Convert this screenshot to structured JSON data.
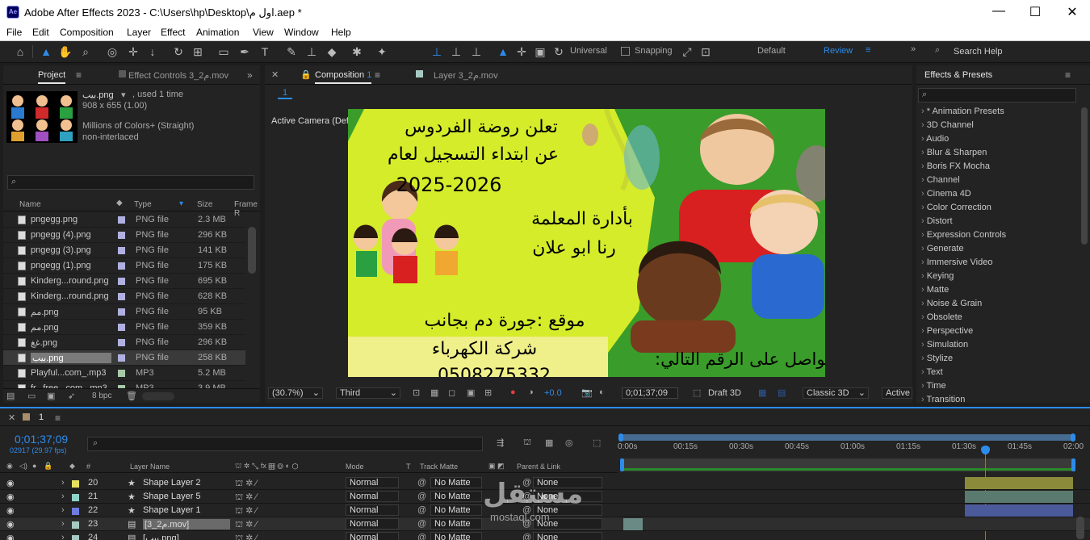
{
  "window": {
    "title": "Adobe After Effects 2023 - C:\\Users\\hp\\Desktop\\اول م.aep *",
    "logo": "Ae",
    "min": "—",
    "max": "☐",
    "close": "✕"
  },
  "menu": [
    "File",
    "Edit",
    "Composition",
    "Layer",
    "Effect",
    "Animation",
    "View",
    "Window",
    "Help"
  ],
  "toolbar": {
    "universal": "Universal",
    "snapping": "Snapping",
    "workspace_default": "Default",
    "workspace_review": "Review",
    "search_help": "Search Help"
  },
  "project": {
    "tab": "Project",
    "effect_controls_tab": "Effect Controls 3_2م.mov",
    "item_name": "بيب.png",
    "used": ", used 1 time",
    "dims": "908 x 655 (1.00)",
    "colors": "Millions of Colors+ (Straight)",
    "interlace": "non-interlaced",
    "bpc": "8 bpc",
    "columns": [
      "Name",
      "Type",
      "Size",
      "Frame R"
    ],
    "files": [
      {
        "name": "pngegg.png",
        "type": "PNG file",
        "size": "2.3 MB"
      },
      {
        "name": "pngegg (4).png",
        "type": "PNG file",
        "size": "296 KB"
      },
      {
        "name": "pngegg (3).png",
        "type": "PNG file",
        "size": "141 KB"
      },
      {
        "name": "pngegg (1).png",
        "type": "PNG file",
        "size": "175 KB"
      },
      {
        "name": "Kinderg...round.png",
        "type": "PNG file",
        "size": "695 KB"
      },
      {
        "name": "Kinderg...round.png",
        "type": "PNG file",
        "size": "628 KB"
      },
      {
        "name": "مم.png",
        "type": "PNG file",
        "size": "95 KB"
      },
      {
        "name": "مم.png",
        "type": "PNG file",
        "size": "359 KB"
      },
      {
        "name": "غغ.png",
        "type": "PNG file",
        "size": "296 KB"
      },
      {
        "name": "بيب.png",
        "type": "PNG file",
        "size": "258 KB"
      },
      {
        "name": "Playful...com_.mp3",
        "type": "MP3",
        "size": "5.2 MB"
      },
      {
        "name": "fr...free...com_.mp3",
        "type": "MP3",
        "size": "3.9 MB"
      }
    ]
  },
  "composition": {
    "tab": "Composition",
    "tab_num": "1",
    "layer_tab": "Layer 3_2م.mov",
    "breadcrumb": "1",
    "camera": "Active Camera (Default)",
    "zoom": "(30.7%)",
    "view": "Third",
    "exposure": "+0.0",
    "timecode": "0;01;37;09",
    "renderer": "Draft 3D",
    "engine": "Classic 3D",
    "camera_dd": "Active",
    "frame": {
      "line1": "تعلن روضة الفردوس",
      "line2": "عن ابتداء التسجيل لعام",
      "line3": "2025-2026",
      "line4": "بأدارة المعلمة",
      "line5": "رنا ابو علان",
      "line6": "موقع :جورة دم بجانب",
      "line7": "شركة الكهرباء",
      "line8": "0508275332",
      "line9": "تواصل على الرقم التالي:"
    }
  },
  "effects": {
    "title": "Effects & Presets",
    "items": [
      "* Animation Presets",
      "3D Channel",
      "Audio",
      "Blur & Sharpen",
      "Boris FX Mocha",
      "Channel",
      "Cinema 4D",
      "Color Correction",
      "Distort",
      "Expression Controls",
      "Generate",
      "Immersive Video",
      "Keying",
      "Matte",
      "Noise & Grain",
      "Obsolete",
      "Perspective",
      "Simulation",
      "Stylize",
      "Text",
      "Time",
      "Transition"
    ]
  },
  "timeline": {
    "tab": "1",
    "timecode": "0;01;37;09",
    "frames": "02917 (29.97 fps)",
    "columns": {
      "num": "#",
      "layer_name": "Layer Name",
      "mode": "Mode",
      "t": "T",
      "track_matte": "Track Matte",
      "parent": "Parent & Link"
    },
    "ruler": [
      "0:00s",
      "00:15s",
      "00:30s",
      "00:45s",
      "01:00s",
      "01:15s",
      "01:30s",
      "01:45s",
      "02:00"
    ],
    "layers": [
      {
        "num": "20",
        "name": "Shape Layer 2",
        "mode": "Normal",
        "matte": "No Matte",
        "parent": "None",
        "color": "#e6e060"
      },
      {
        "num": "21",
        "name": "Shape Layer 5",
        "mode": "Normal",
        "matte": "No Matte",
        "parent": "None",
        "color": "#8fd3c8"
      },
      {
        "num": "22",
        "name": "Shape Layer 1",
        "mode": "Normal",
        "matte": "No Matte",
        "parent": "None",
        "color": "#6e7be0"
      },
      {
        "num": "23",
        "name": "[3_2م.mov]",
        "mode": "Normal",
        "matte": "No Matte",
        "parent": "None",
        "color": "#a7c9c3"
      },
      {
        "num": "24",
        "name": "[بيب.png]",
        "mode": "Normal",
        "matte": "No Matte",
        "parent": "None",
        "color": "#a7c9c3"
      }
    ]
  },
  "watermark": {
    "main": "مستقل",
    "sub": "mostaql.com"
  }
}
